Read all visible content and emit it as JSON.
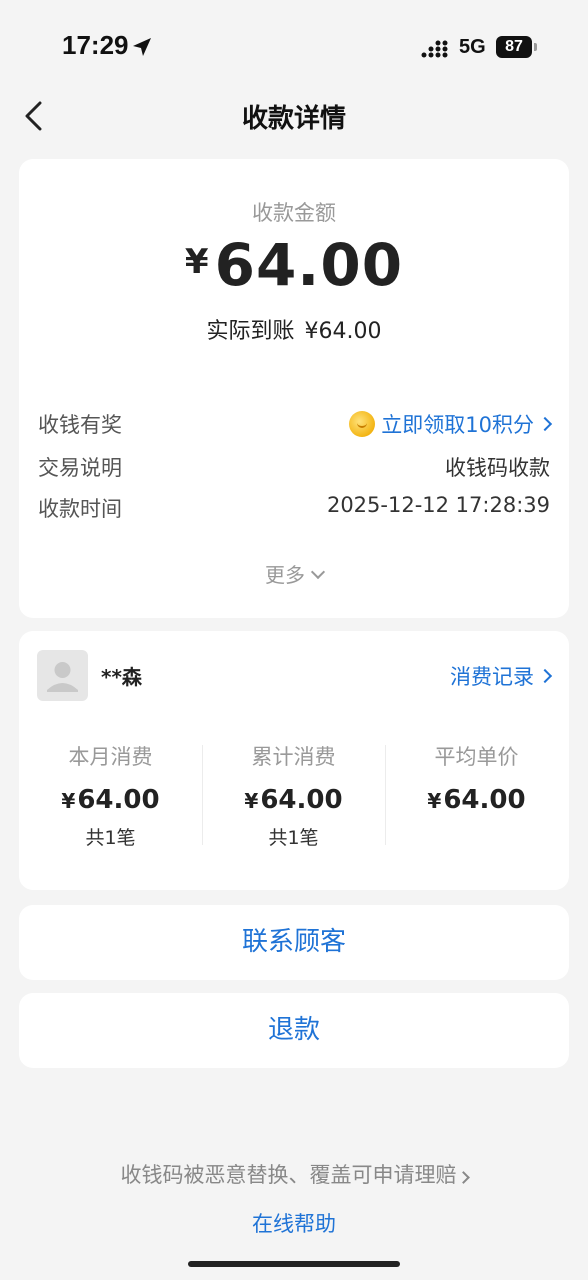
{
  "status_bar": {
    "time": "17:29",
    "network": "5G",
    "battery": "87",
    "icons": [
      "location-arrow-icon",
      "signal-icon"
    ]
  },
  "nav": {
    "title": "收款详情",
    "back_icon": "chevron-left-icon"
  },
  "payment": {
    "amount_label": "收款金额",
    "currency": "¥",
    "amount": "64.00",
    "received_label": "实际到账",
    "received_value": "¥64.00",
    "rows": [
      {
        "label": "收钱有奖",
        "value": "立即领取10积分",
        "icon": "coin-icon",
        "link": true
      },
      {
        "label": "交易说明",
        "value": "收钱码收款"
      },
      {
        "label": "收款时间",
        "value": "2025-12-12 17:28:39"
      }
    ],
    "more_label": "更多"
  },
  "customer": {
    "name": "**森",
    "history_label": "消费记录",
    "stats": [
      {
        "label": "本月消费",
        "currency": "¥",
        "value": "64.00",
        "count": "共1笔"
      },
      {
        "label": "累计消费",
        "currency": "¥",
        "value": "64.00",
        "count": "共1笔"
      },
      {
        "label": "平均单价",
        "currency": "¥",
        "value": "64.00",
        "count": ""
      }
    ]
  },
  "actions": {
    "contact": "联系顾客",
    "refund": "退款"
  },
  "footer": {
    "claim_text": "收钱码被恶意替换、覆盖可申请理赔",
    "help_text": "在线帮助"
  },
  "colors": {
    "background": "#f4f4f4",
    "card": "#ffffff",
    "accent": "#1f73d6",
    "muted": "#999999"
  }
}
